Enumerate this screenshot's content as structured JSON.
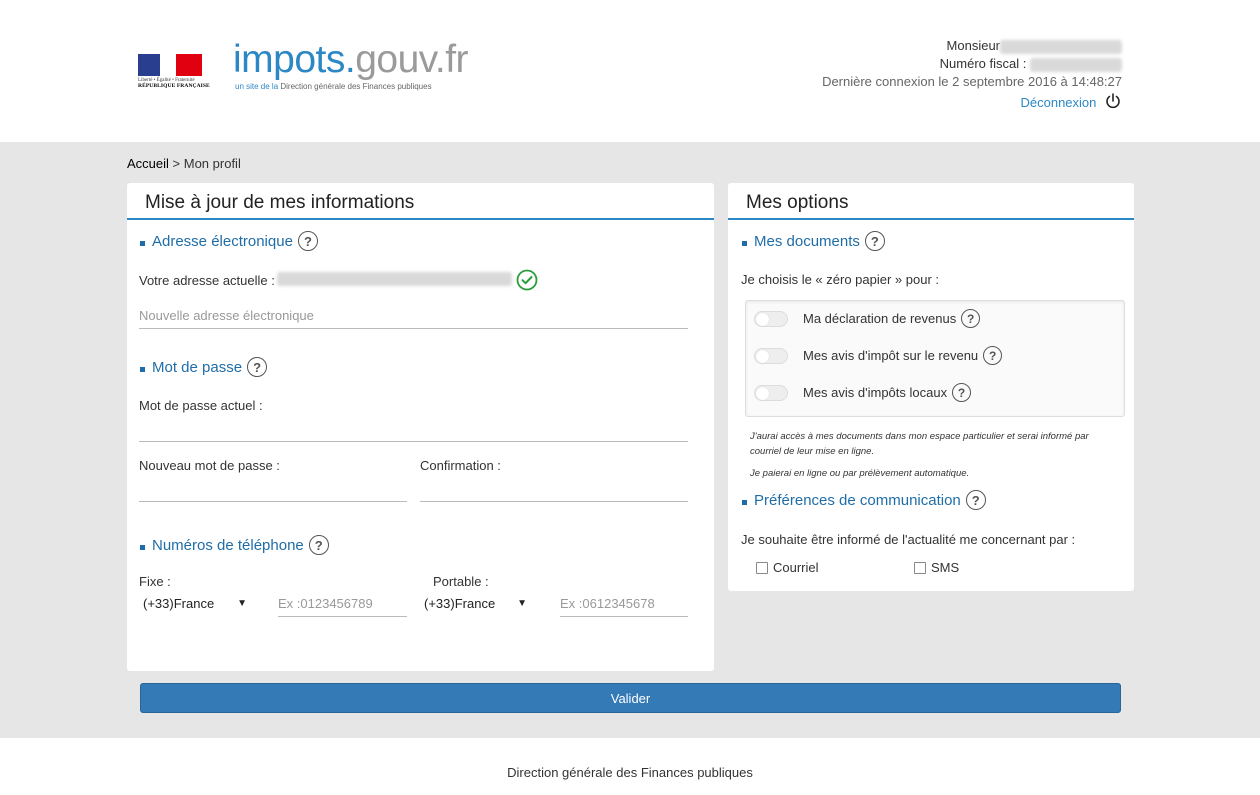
{
  "header": {
    "marianne_devise": "Liberté • Égalité • Fraternité",
    "marianne_republic": "RÉPUBLIQUE FRANÇAISE",
    "brand_part1": "impots.",
    "brand_part2": "gouv.fr",
    "tagline_prefix": "un site de la ",
    "tagline_main": "Direction générale des Finances publiques",
    "civility_label": "Monsieur",
    "fiscal_number_label": "Numéro fiscal :",
    "last_login": "Dernière connexion le 2 septembre 2016 à 14:48:27",
    "logout_label": "Déconnexion"
  },
  "breadcrumb": {
    "home": "Accueil",
    "separator": " > ",
    "current": "Mon profil"
  },
  "left_panel": {
    "title": "Mise à jour de mes informations",
    "email_section": {
      "title": "Adresse électronique",
      "current_label": "Votre adresse actuelle :",
      "new_placeholder": "Nouvelle adresse électronique"
    },
    "password_section": {
      "title": "Mot de passe",
      "current_label": "Mot de passe actuel :",
      "new_label": "Nouveau mot de passe :",
      "confirm_label": "Confirmation :"
    },
    "phone_section": {
      "title": "Numéros de téléphone",
      "fixed_label": "Fixe :",
      "mobile_label": "Portable :",
      "fixed_country": "(+33)France",
      "mobile_country": "(+33)France",
      "fixed_placeholder": "Ex :0123456789",
      "mobile_placeholder": "Ex :0612345678"
    }
  },
  "right_panel": {
    "title": "Mes options",
    "documents_section": {
      "title": "Mes documents",
      "intro": "Je choisis le « zéro papier » pour :",
      "options": [
        {
          "label": "Ma déclaration de revenus",
          "enabled": false
        },
        {
          "label": "Mes avis d'impôt sur le revenu",
          "enabled": false
        },
        {
          "label": "Mes avis d'impôts locaux",
          "enabled": false
        }
      ],
      "note1": "J'aurai accès à mes documents dans mon espace particulier et serai informé par courriel de leur mise en ligne.",
      "note2": "Je paierai en ligne ou par prélèvement automatique."
    },
    "communication_section": {
      "title": "Préférences de communication",
      "intro": "Je souhaite être informé de l'actualité me concernant par :",
      "mail_label": "Courriel",
      "sms_label": "SMS"
    }
  },
  "actions": {
    "validate_label": "Valider"
  },
  "footer": {
    "text": "Direction générale des Finances publiques"
  },
  "colors": {
    "accent": "#2c88c4",
    "section_title": "#1f6da8",
    "button": "#337ab7",
    "success": "#2a9d3a",
    "background": "#e6e6e6"
  },
  "icons": {
    "help": "question-circle-icon",
    "verified": "check-circle-icon",
    "logout": "power-icon"
  }
}
